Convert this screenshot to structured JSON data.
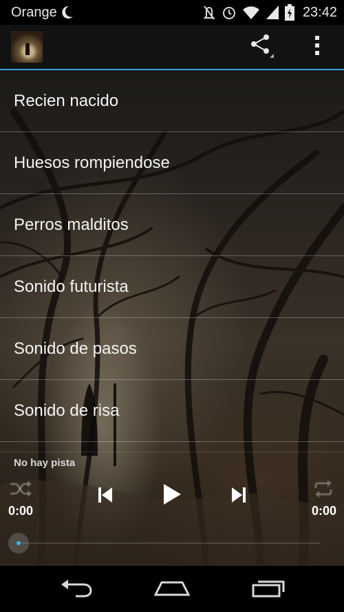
{
  "status_bar": {
    "carrier": "Orange",
    "time": "23:42",
    "icons": [
      "moon-icon",
      "mute-icon",
      "alarm-icon",
      "wifi-icon",
      "signal-icon",
      "battery-icon"
    ]
  },
  "action_bar": {
    "icons": [
      "app-icon",
      "share-icon",
      "overflow-menu-icon"
    ],
    "accent_color": "#33a0d8"
  },
  "sounds": [
    {
      "label": "Recien nacido"
    },
    {
      "label": "Huesos rompiendose"
    },
    {
      "label": "Perros malditos"
    },
    {
      "label": "Sonido futurista"
    },
    {
      "label": "Sonido de pasos"
    },
    {
      "label": "Sonido de risa"
    }
  ],
  "player": {
    "track": "No hay pista",
    "time_current": "0:00",
    "time_total": "0:00",
    "progress": 0,
    "icons": [
      "shuffle-icon",
      "previous-icon",
      "play-icon",
      "next-icon",
      "repeat-icon"
    ],
    "seek_accent_color": "#33b5e5"
  },
  "nav_bar": {
    "icons": [
      "back-icon",
      "home-icon",
      "recents-icon"
    ]
  }
}
